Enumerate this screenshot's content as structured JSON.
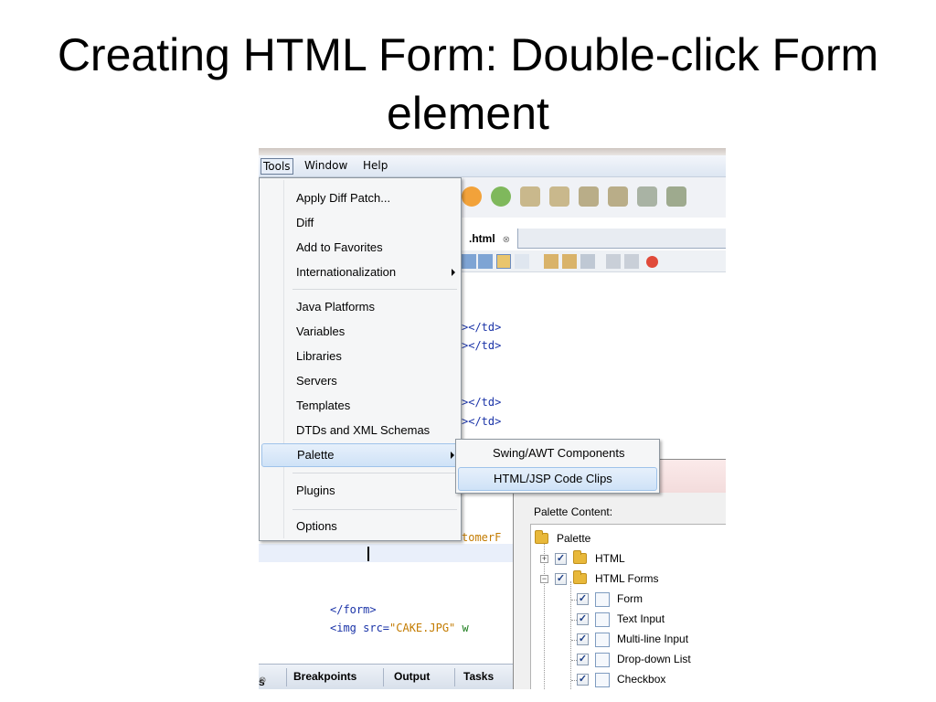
{
  "slide": {
    "title": "Creating HTML Form: Double-click Form element"
  },
  "menubar": {
    "tools": "Tools",
    "window": "Window",
    "help": "Help"
  },
  "tools_menu": {
    "items": [
      "Apply Diff Patch...",
      "Diff",
      "Add to Favorites",
      "Internationalization",
      "Java Platforms",
      "Variables",
      "Libraries",
      "Servers",
      "Templates",
      "DTDs and XML Schemas",
      "Palette",
      "Plugins",
      "Options"
    ]
  },
  "palette_submenu": {
    "items": [
      "Swing/AWT Components",
      "HTML/JSP Code Clips"
    ]
  },
  "editor": {
    "file_tab": ".html",
    "close_glyph": "⊗",
    "code_lines": [
      ">",
      "</td>",
      "</td>",
      "</td>",
      "</td>"
    ],
    "code_fragment_right": "tomerF",
    "form_close": "</form>",
    "img_tag_start": "<img src=",
    "img_src": "\"CAKE.JPG\"",
    "img_tag_rest": " w"
  },
  "palette_dialog": {
    "label": "Palette Content:",
    "tree": {
      "root": "Palette",
      "html": "HTML",
      "html_forms": "HTML Forms",
      "children": [
        "Form",
        "Text Input",
        "Multi-line Input",
        "Drop-down List",
        "Checkbox"
      ]
    }
  },
  "bottom_tabs": {
    "first_suffix": "s",
    "close_glyph": "⊗",
    "breakpoints": "Breakpoints",
    "output": "Output",
    "tasks": "Tasks"
  },
  "colors": {
    "highlight": "#cfe2f7",
    "code_tag": "#1b34a8",
    "code_string": "#c37b00",
    "folder": "#e8b83a"
  }
}
